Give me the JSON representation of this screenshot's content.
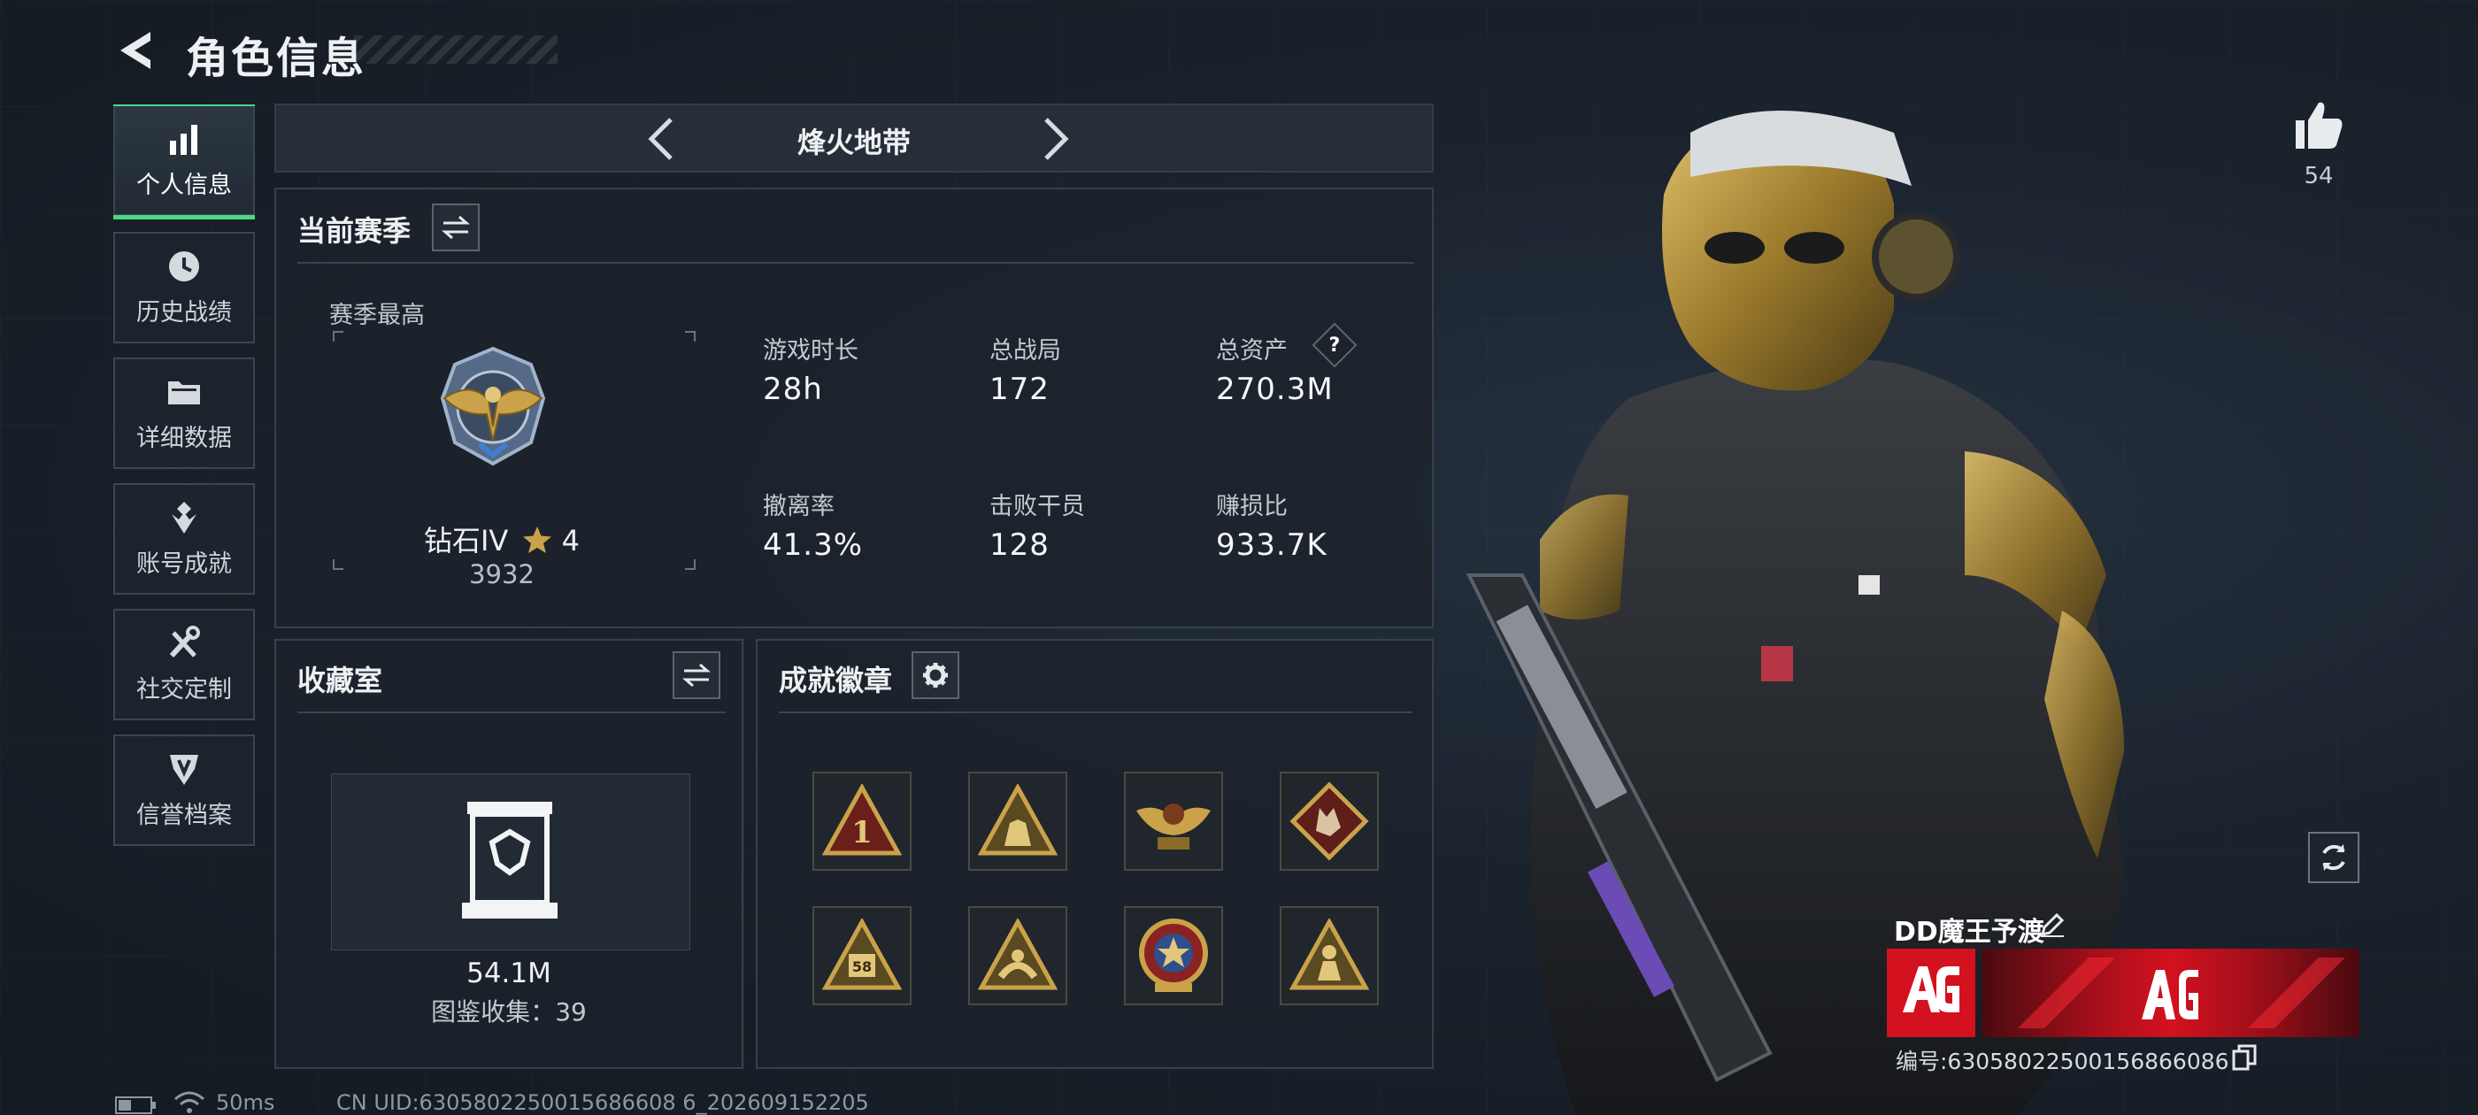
{
  "header": {
    "title": "角色信息"
  },
  "nav": {
    "items": [
      {
        "label": "个人信息",
        "active": true
      },
      {
        "label": "历史战绩"
      },
      {
        "label": "详细数据"
      },
      {
        "label": "账号成就"
      },
      {
        "label": "社交定制"
      },
      {
        "label": "信誉档案"
      }
    ]
  },
  "mode": {
    "name": "烽火地带"
  },
  "season": {
    "title": "当前赛季",
    "best_label": "赛季最高",
    "rank_name": "钻石IV",
    "rank_stars": "4",
    "rank_score": "3932",
    "stats": [
      {
        "label": "游戏时长",
        "value": "28h"
      },
      {
        "label": "总战局",
        "value": "172"
      },
      {
        "label": "总资产",
        "value": "270.3M",
        "help": "?"
      },
      {
        "label": "撤离率",
        "value": "41.3%"
      },
      {
        "label": "击败干员",
        "value": "128"
      },
      {
        "label": "赚损比",
        "value": "933.7K"
      }
    ]
  },
  "collection": {
    "title": "收藏室",
    "value": "54.1M",
    "catalog_label": "图鉴收集：",
    "catalog_count": "39"
  },
  "badges": {
    "title": "成就徽章",
    "items": [
      {
        "icon": "rank-1-triangle-badge-icon"
      },
      {
        "icon": "soldiers-triangle-badge-icon"
      },
      {
        "icon": "winged-crest-badge-icon"
      },
      {
        "icon": "wolf-diamond-badge-icon"
      },
      {
        "icon": "number-58-triangle-badge-icon"
      },
      {
        "icon": "hands-triangle-badge-icon"
      },
      {
        "icon": "star-medal-badge-icon"
      },
      {
        "icon": "figure-triangle-badge-icon"
      }
    ]
  },
  "player": {
    "likes": "54",
    "name": "DD魔王予渡",
    "id_text": "编号:6305802250015686608​6"
  },
  "status": {
    "ping": "50ms",
    "uid": "CN UID:6305802250015686608 6_202609152205"
  },
  "colors": {
    "accent": "#4bd68a",
    "gold": "#c9a24a",
    "banner_red": "#d4111f"
  }
}
